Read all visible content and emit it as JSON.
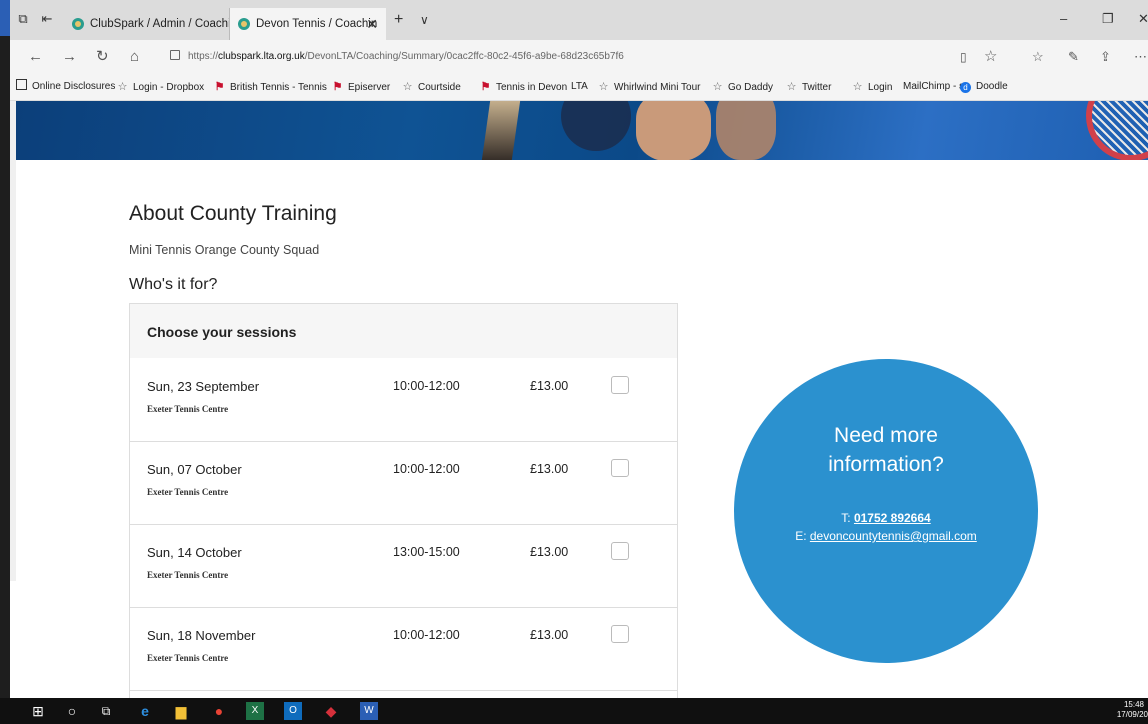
{
  "browser": {
    "tabs": [
      {
        "label": "ClubSpark / Admin / Coachi"
      },
      {
        "label": "Devon Tennis / Coachin"
      }
    ],
    "new_tab_glyph": "+",
    "tab_menu_glyph": "∨",
    "url": {
      "prefix": "https://",
      "host": "clubspark.lta.org.uk",
      "path": "/DevonLTA/Coaching/Summary/0cac2ffc-80c2-45f6-a9be-68d23c65b7f6"
    },
    "favorites": [
      {
        "label": "Online Disclosures",
        "icon": "page-icon"
      },
      {
        "label": "Login - Dropbox",
        "icon": "star-icon"
      },
      {
        "label": "British Tennis - Tennis",
        "icon": "flag-icon"
      },
      {
        "label": "Episerver",
        "icon": "flag-icon"
      },
      {
        "label": "Courtside",
        "icon": "star-icon"
      },
      {
        "label": "Tennis in Devon",
        "icon": "flag-icon"
      },
      {
        "label": "LTA",
        "icon": "none"
      },
      {
        "label": "Whirlwind Mini Tour",
        "icon": "star-icon"
      },
      {
        "label": "Go Daddy",
        "icon": "star-icon"
      },
      {
        "label": "Twitter",
        "icon": "star-icon"
      },
      {
        "label": "Login",
        "icon": "star-icon"
      },
      {
        "label": "MailChimp - ε",
        "icon": "none"
      },
      {
        "label": "Doodle",
        "icon": "doodle-icon"
      }
    ]
  },
  "page": {
    "title": "About County Training",
    "subtitle": "Mini Tennis Orange County Squad",
    "who_heading": "Who's it for?",
    "sessions_heading": "Choose your sessions",
    "sessions": [
      {
        "date": "Sun, 23 September",
        "venue": "Exeter Tennis Centre",
        "time": "10:00-12:00",
        "price": "£13.00"
      },
      {
        "date": "Sun, 07 October",
        "venue": "Exeter Tennis Centre",
        "time": "10:00-12:00",
        "price": "£13.00"
      },
      {
        "date": "Sun, 14 October",
        "venue": "Exeter Tennis Centre",
        "time": "13:00-15:00",
        "price": "£13.00"
      },
      {
        "date": "Sun, 18 November",
        "venue": "Exeter Tennis Centre",
        "time": "10:00-12:00",
        "price": "£13.00"
      }
    ],
    "info": {
      "heading_line1": "Need more",
      "heading_line2": "information?",
      "phone_prefix": "T: ",
      "phone": "01752 892664",
      "email_prefix": "E: ",
      "email": "devoncountytennis@gmail.com"
    }
  },
  "taskbar": {
    "time": "15:48",
    "date": "17/09/20"
  },
  "colors": {
    "accent": "#2b91cf",
    "hero": "#0f5394"
  }
}
